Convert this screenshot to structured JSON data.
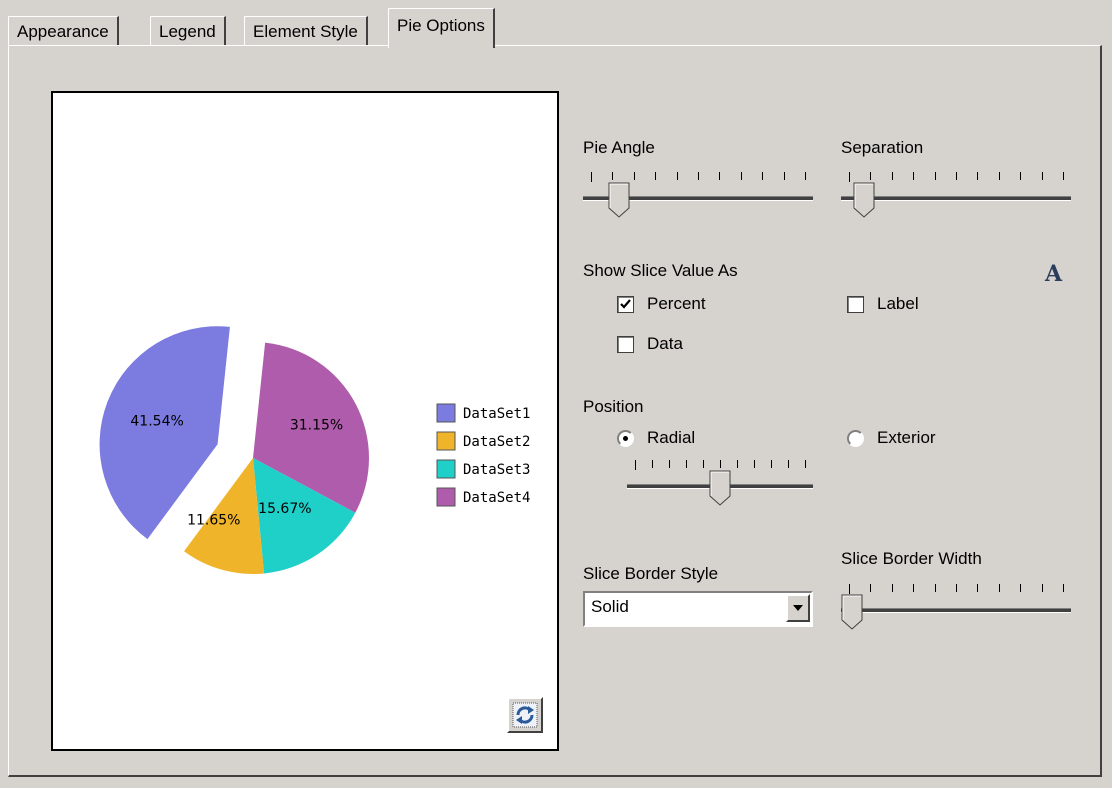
{
  "tabs": [
    {
      "label": "Appearance",
      "active": false
    },
    {
      "label": "Legend",
      "active": false
    },
    {
      "label": "Element Style",
      "active": false
    },
    {
      "label": "Pie Options",
      "active": true
    }
  ],
  "preview": {
    "refresh_icon": "refresh-icon"
  },
  "chart_data": {
    "type": "pie",
    "slices": [
      {
        "name": "DataSet1",
        "value": 41.54,
        "label": "41.54%",
        "color": "#7b7be0",
        "exploded": true
      },
      {
        "name": "DataSet2",
        "value": 11.65,
        "label": "11.65%",
        "color": "#f0b42a",
        "exploded": false
      },
      {
        "name": "DataSet3",
        "value": 15.67,
        "label": "15.67%",
        "color": "#1fd0c8",
        "exploded": false
      },
      {
        "name": "DataSet4",
        "value": 31.15,
        "label": "31.15%",
        "color": "#b05cac",
        "exploded": false
      }
    ],
    "legend": [
      "DataSet1",
      "DataSet2",
      "DataSet3",
      "DataSet4"
    ],
    "legend_position": "right"
  },
  "pie_angle": {
    "label": "Pie Angle",
    "value": 0.12
  },
  "separation": {
    "label": "Separation",
    "value": 0.06
  },
  "show_slice": {
    "label": "Show Slice Value As",
    "percent": {
      "label": "Percent",
      "checked": true
    },
    "label_opt": {
      "label": "Label",
      "checked": false
    },
    "data": {
      "label": "Data",
      "checked": false
    },
    "font_icon": "A"
  },
  "position": {
    "label": "Position",
    "radial": {
      "label": "Radial",
      "selected": true
    },
    "exterior": {
      "label": "Exterior",
      "selected": false
    },
    "radial_slider_value": 0.5
  },
  "slice_border_style": {
    "label": "Slice Border Style",
    "value": "Solid"
  },
  "slice_border_width": {
    "label": "Slice Border Width",
    "value": 0.0
  }
}
